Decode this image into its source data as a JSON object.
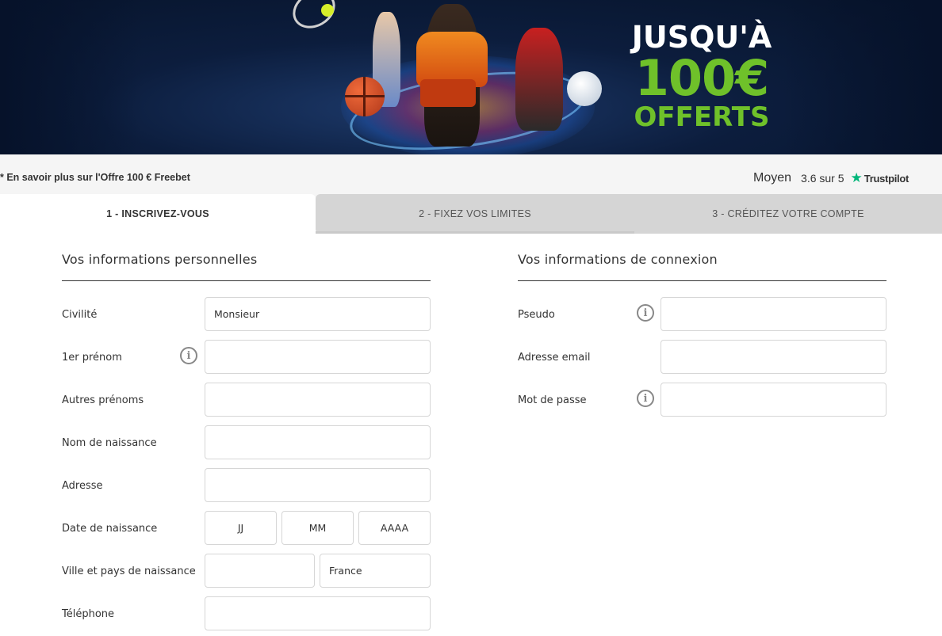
{
  "banner": {
    "promo_line1": "JUSQU'À",
    "promo_line2": "100€",
    "promo_line3": "OFFERTS"
  },
  "infobar": {
    "offer_link": "* En savoir plus sur l'Offre 100 € Freebet",
    "trust_word": "Moyen",
    "trust_score": "3.6 sur 5",
    "trust_brand": "Trustpilot"
  },
  "tabs": [
    {
      "label": "1 - INSCRIVEZ-VOUS",
      "active": true
    },
    {
      "label": "2 - FIXEZ VOS LIMITES",
      "active": false
    },
    {
      "label": "3 - CRÉDITEZ VOTRE COMPTE",
      "active": false
    }
  ],
  "personal": {
    "title": "Vos informations personnelles",
    "civilite_label": "Civilité",
    "civilite_value": "Monsieur",
    "prenom_label": "1er prénom",
    "autres_prenoms_label": "Autres prénoms",
    "nom_label": "Nom de naissance",
    "adresse_label": "Adresse",
    "date_label": "Date de naissance",
    "date_day": "JJ",
    "date_month": "MM",
    "date_year": "AAAA",
    "ville_label": "Ville et pays de naissance",
    "pays_value": "France",
    "telephone_label": "Téléphone"
  },
  "connexion": {
    "title": "Vos informations de connexion",
    "pseudo_label": "Pseudo",
    "email_label": "Adresse email",
    "password_label": "Mot de passe"
  },
  "colors": {
    "promo_green": "#6fc12a",
    "trustpilot_green": "#00b67a",
    "tab_inactive": "#d5d5d5"
  }
}
